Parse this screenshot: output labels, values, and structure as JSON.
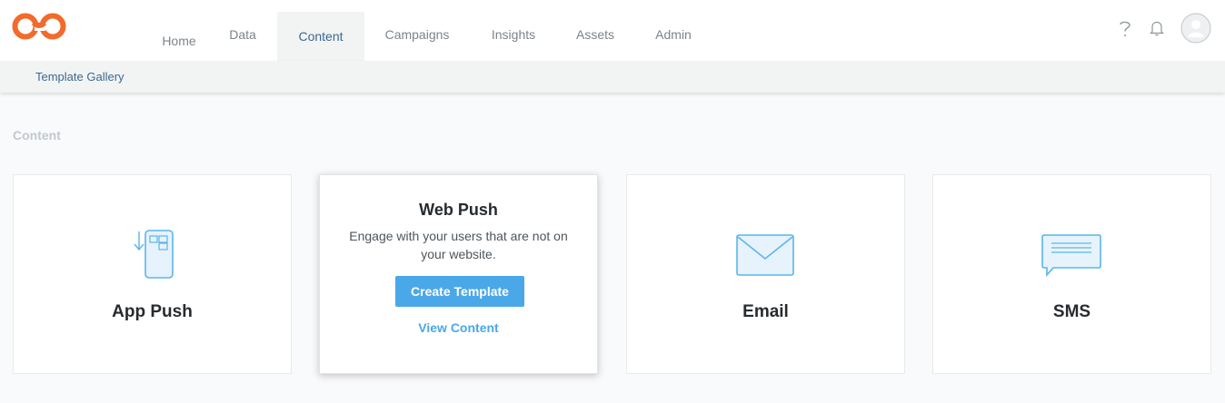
{
  "nav": {
    "tabs": [
      {
        "label": "Home"
      },
      {
        "label": "Data"
      },
      {
        "label": "Content"
      },
      {
        "label": "Campaigns"
      },
      {
        "label": "Insights"
      },
      {
        "label": "Assets"
      },
      {
        "label": "Admin"
      }
    ],
    "active_tab": "Content",
    "icons": [
      "help-icon",
      "bell-icon",
      "avatar-icon"
    ]
  },
  "subnav": {
    "link": "Template Gallery"
  },
  "section": {
    "title": "Content"
  },
  "cards": [
    {
      "label": "App Push",
      "icon": "phone-push-icon"
    },
    {
      "title": "Web Push",
      "description": "Engage with your users that are not on your website.",
      "button": "Create Template",
      "link": "View Content"
    },
    {
      "label": "Email",
      "icon": "envelope-icon"
    },
    {
      "label": "SMS",
      "icon": "chat-bubble-icon"
    }
  ],
  "colors": {
    "brand": "#f26b2c",
    "accent": "#4aa8e8",
    "nav_active_text": "#3b6a8f"
  }
}
